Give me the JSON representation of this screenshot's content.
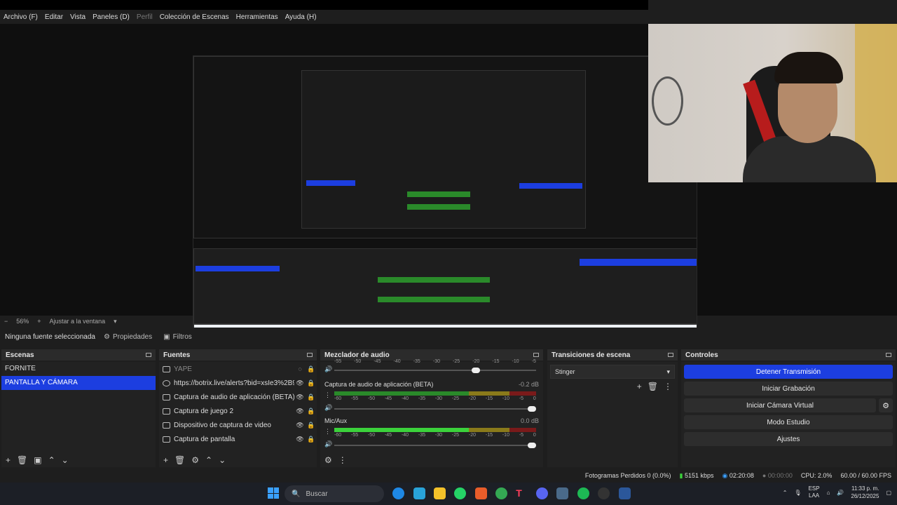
{
  "menu": [
    "Archivo (F)",
    "Editar",
    "Vista",
    "Paneles (D)",
    "Perfil",
    "Colección de Escenas",
    "Herramientas",
    "Ayuda (H)"
  ],
  "zoom": {
    "minus": "−",
    "value": "56%",
    "plus": "+",
    "fit": "Ajustar a la ventana"
  },
  "propbar": {
    "no_source": "Ninguna fuente seleccionada",
    "properties": "Propiedades",
    "filters": "Filtros"
  },
  "scenes": {
    "title": "Escenas",
    "items": [
      "FORNITE",
      "PANTALLA Y CÁMARA"
    ]
  },
  "sources": {
    "title": "Fuentes",
    "items": [
      {
        "name": "YAPE"
      },
      {
        "name": "https://botrix.live/alerts?bid=xsIe3%2B9"
      },
      {
        "name": "Captura de audio de aplicación (BETA)"
      },
      {
        "name": "Captura de juego 2"
      },
      {
        "name": "Dispositivo de captura de video"
      },
      {
        "name": "Captura de pantalla"
      }
    ]
  },
  "mixer": {
    "title": "Mezclador de audio",
    "ticks": [
      "-60",
      "-55",
      "-50",
      "-45",
      "-40",
      "-35",
      "-30",
      "-25",
      "-20",
      "-15",
      "-10",
      "-5",
      "0"
    ],
    "channels": [
      {
        "name": "Captura de audio de aplicación (BETA)",
        "db": "-0.2 dB"
      },
      {
        "name": "Mic/Aux",
        "db": "0.0 dB"
      }
    ]
  },
  "transitions": {
    "title": "Transiciones de escena",
    "selected": "Stinger"
  },
  "controls": {
    "title": "Controles",
    "buttons": [
      "Detener Transmisión",
      "Iniciar Grabación",
      "Iniciar Cámara Virtual",
      "Modo Estudio",
      "Ajustes"
    ]
  },
  "status": {
    "dropped": "Fotogramas Perdidos 0 (0.0%)",
    "bitrate": "5151 kbps",
    "live_time": "02:20:08",
    "rec_time": "00:00:00",
    "cpu": "CPU: 2.0%",
    "fps": "60.00 / 60.00 FPS"
  },
  "taskbar": {
    "search": "Buscar",
    "lang": "ESP",
    "lang2": "LAA",
    "time": "11:33 p. m.",
    "date": "26/12/2025"
  },
  "colors": {
    "accent": "#1c3ee0",
    "meter_green": "#2a8a2a",
    "meter_yellow": "#8a7a1a",
    "meter_red": "#7a1a1a"
  }
}
